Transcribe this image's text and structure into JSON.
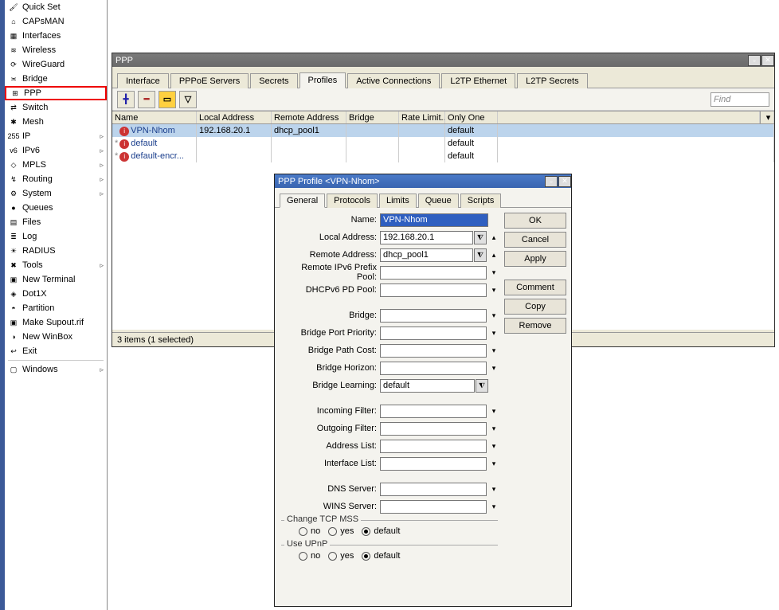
{
  "sidebar": [
    {
      "label": "Quick Set",
      "icon": "🖌"
    },
    {
      "label": "CAPsMAN",
      "icon": "⌂"
    },
    {
      "label": "Interfaces",
      "icon": "▦"
    },
    {
      "label": "Wireless",
      "icon": "≋"
    },
    {
      "label": "WireGuard",
      "icon": "⟳"
    },
    {
      "label": "Bridge",
      "icon": "≍"
    },
    {
      "label": "PPP",
      "icon": "⊞",
      "hl": true
    },
    {
      "label": "Switch",
      "icon": "⇄"
    },
    {
      "label": "Mesh",
      "icon": "✱"
    },
    {
      "label": "IP",
      "icon": "255",
      "sub": true
    },
    {
      "label": "IPv6",
      "icon": "v6",
      "sub": true
    },
    {
      "label": "MPLS",
      "icon": "◇",
      "sub": true
    },
    {
      "label": "Routing",
      "icon": "↯",
      "sub": true
    },
    {
      "label": "System",
      "icon": "⚙",
      "sub": true
    },
    {
      "label": "Queues",
      "icon": "●"
    },
    {
      "label": "Files",
      "icon": "▤"
    },
    {
      "label": "Log",
      "icon": "≣"
    },
    {
      "label": "RADIUS",
      "icon": "☀"
    },
    {
      "label": "Tools",
      "icon": "✖",
      "sub": true
    },
    {
      "label": "New Terminal",
      "icon": "▣"
    },
    {
      "label": "Dot1X",
      "icon": "◈"
    },
    {
      "label": "Partition",
      "icon": "◓"
    },
    {
      "label": "Make Supout.rif",
      "icon": "▣"
    },
    {
      "label": "New WinBox",
      "icon": "◑"
    },
    {
      "label": "Exit",
      "icon": "↩"
    },
    {
      "sep": true
    },
    {
      "label": "Windows",
      "icon": "▢",
      "sub": true
    }
  ],
  "ppp": {
    "title": "PPP",
    "tabs": [
      "Interface",
      "PPPoE Servers",
      "Secrets",
      "Profiles",
      "Active Connections",
      "L2TP Ethernet",
      "L2TP Secrets"
    ],
    "activeTab": "Profiles",
    "find_placeholder": "Find",
    "columns": [
      "Name",
      "Local Address",
      "Remote Address",
      "Bridge",
      "Rate Limit...",
      "Only One"
    ],
    "rows": [
      {
        "star": "",
        "name": "VPN-Nhom",
        "local": "192.168.20.1",
        "remote": "dhcp_pool1",
        "bridge": "",
        "rate": "",
        "only": "default",
        "sel": true
      },
      {
        "star": "*",
        "name": "default",
        "local": "",
        "remote": "",
        "bridge": "",
        "rate": "",
        "only": "default"
      },
      {
        "star": "*",
        "name": "default-encr...",
        "local": "",
        "remote": "",
        "bridge": "",
        "rate": "",
        "only": "default"
      }
    ],
    "status": "3 items (1 selected)"
  },
  "dlg": {
    "title": "PPP Profile <VPN-Nhom>",
    "tabs": [
      "General",
      "Protocols",
      "Limits",
      "Queue",
      "Scripts"
    ],
    "activeTab": "General",
    "actions": [
      "OK",
      "Cancel",
      "Apply",
      "Comment",
      "Copy",
      "Remove"
    ],
    "hlActions": [
      "OK",
      "Apply"
    ],
    "fields": {
      "name_label": "Name:",
      "name": "VPN-Nhom",
      "local_label": "Local Address:",
      "local": "192.168.20.1",
      "remote_label": "Remote Address:",
      "remote": "dhcp_pool1",
      "ipv6pool_label": "Remote IPv6 Prefix Pool:",
      "dhcpv6_label": "DHCPv6 PD Pool:",
      "bridge_label": "Bridge:",
      "bpp_label": "Bridge Port Priority:",
      "bpc_label": "Bridge Path Cost:",
      "bh_label": "Bridge Horizon:",
      "bl_label": "Bridge Learning:",
      "bl": "default",
      "inf_label": "Incoming Filter:",
      "outf_label": "Outgoing Filter:",
      "alist_label": "Address List:",
      "ilist_label": "Interface List:",
      "dns_label": "DNS Server:",
      "wins_label": "WINS Server:",
      "mss_legend": "Change TCP MSS",
      "upnp_legend": "Use UPnP",
      "radio_no": "no",
      "radio_yes": "yes",
      "radio_default": "default"
    }
  }
}
